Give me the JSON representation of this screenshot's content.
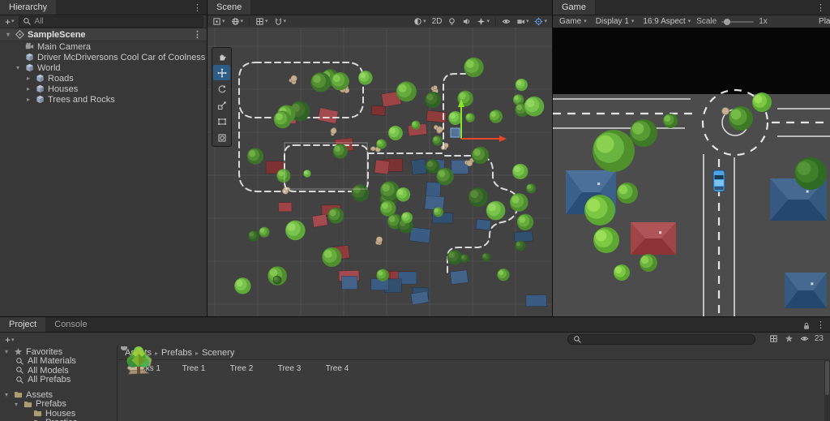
{
  "glyphs": {
    "kebab": "⋮",
    "caret": "▾",
    "plus": "+",
    "arrow_open": "▾",
    "arrow_closed": "▸",
    "crumb_sep": "▸"
  },
  "colors": {
    "accent_blue": "#2C5D87",
    "gizmo_green": "#8CE32C",
    "gizmo_red": "#E8472B"
  },
  "hierarchy": {
    "tab": "Hierarchy",
    "search_value": "All",
    "scene_name": "SampleScene",
    "items": [
      {
        "label": "Main Camera",
        "indent": 1,
        "icon": "camera",
        "expanded": null
      },
      {
        "label": "Driver McDriversons Cool Car of Coolness",
        "indent": 1,
        "icon": "cube",
        "expanded": null
      },
      {
        "label": "World",
        "indent": 1,
        "icon": "cube",
        "expanded": true
      },
      {
        "label": "Roads",
        "indent": 2,
        "icon": "cube",
        "expanded": false
      },
      {
        "label": "Houses",
        "indent": 2,
        "icon": "cube",
        "expanded": false
      },
      {
        "label": "Trees and Rocks",
        "indent": 2,
        "icon": "cube",
        "expanded": false
      }
    ]
  },
  "scene": {
    "tab": "Scene",
    "label_2d": "2D"
  },
  "game": {
    "tab": "Game",
    "view": "Game",
    "display": "Display 1",
    "aspect": "16:9 Aspect",
    "scale_label": "Scale",
    "scale_value": "1x",
    "play_label": "Play"
  },
  "project": {
    "tab": "Project",
    "console_tab": "Console",
    "count_badge": "23",
    "breadcrumb": [
      "Assets",
      "Prefabs",
      "Scenery"
    ],
    "favorites_label": "Favorites",
    "favorites": [
      "All Materials",
      "All Models",
      "All Prefabs"
    ],
    "assets_label": "Assets",
    "tree": [
      {
        "label": "Prefabs",
        "indent": 1,
        "expanded": true
      },
      {
        "label": "Houses",
        "indent": 2,
        "expanded": null
      },
      {
        "label": "Practice",
        "indent": 2,
        "expanded": null
      }
    ],
    "assets": [
      {
        "label": "Rocks 1",
        "type": "rocks"
      },
      {
        "label": "Tree 1",
        "type": "tree1"
      },
      {
        "label": "Tree 2",
        "type": "tree2"
      },
      {
        "label": "Tree 3",
        "type": "tree3"
      },
      {
        "label": "Tree 4",
        "type": "tree4"
      }
    ]
  }
}
